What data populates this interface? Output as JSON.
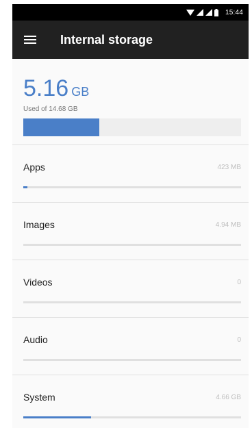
{
  "status_bar": {
    "time": "15:44",
    "icons": [
      "wifi-icon",
      "signal-icon",
      "signal-icon",
      "battery-icon"
    ]
  },
  "app_bar": {
    "menu_icon": "hamburger-menu-icon",
    "title": "Internal storage"
  },
  "summary": {
    "used_value": "5.16",
    "used_unit": "GB",
    "used_of": "Used of 14.68 GB",
    "used_fraction": 0.35
  },
  "categories": [
    {
      "label": "Apps",
      "size": "423 MB",
      "fraction": 0.02
    },
    {
      "label": "Images",
      "size": "4.94 MB",
      "fraction": 0.0
    },
    {
      "label": "Videos",
      "size": "0",
      "fraction": 0.0
    },
    {
      "label": "Audio",
      "size": "0",
      "fraction": 0.0
    },
    {
      "label": "System",
      "size": "4.66 GB",
      "fraction": 0.31
    }
  ],
  "colors": {
    "accent": "#4a7fc8",
    "appbar": "#212121",
    "statusbar": "#000000"
  }
}
